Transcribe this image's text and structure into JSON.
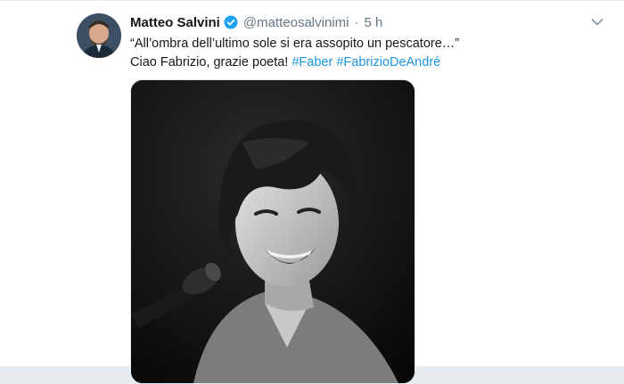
{
  "tweet": {
    "author_name": "Matteo Salvini",
    "author_handle": "@matteosalvinimi",
    "separator": "·",
    "timestamp": "5 h",
    "line1": "“All’ombra dell’ultimo sole si era assopito un pescatore…”",
    "line2_text": "Ciao Fabrizio, grazie poeta!",
    "hashtags": [
      "#Faber",
      "#FabrizioDeAndré"
    ]
  },
  "icons": {
    "verified": "verified-badge-icon",
    "menu": "chevron-down-icon"
  },
  "colors": {
    "link": "#1b95e0",
    "muted": "#657786",
    "text": "#14171a",
    "verified": "#1da1f2",
    "background": "#e6ecf0"
  }
}
